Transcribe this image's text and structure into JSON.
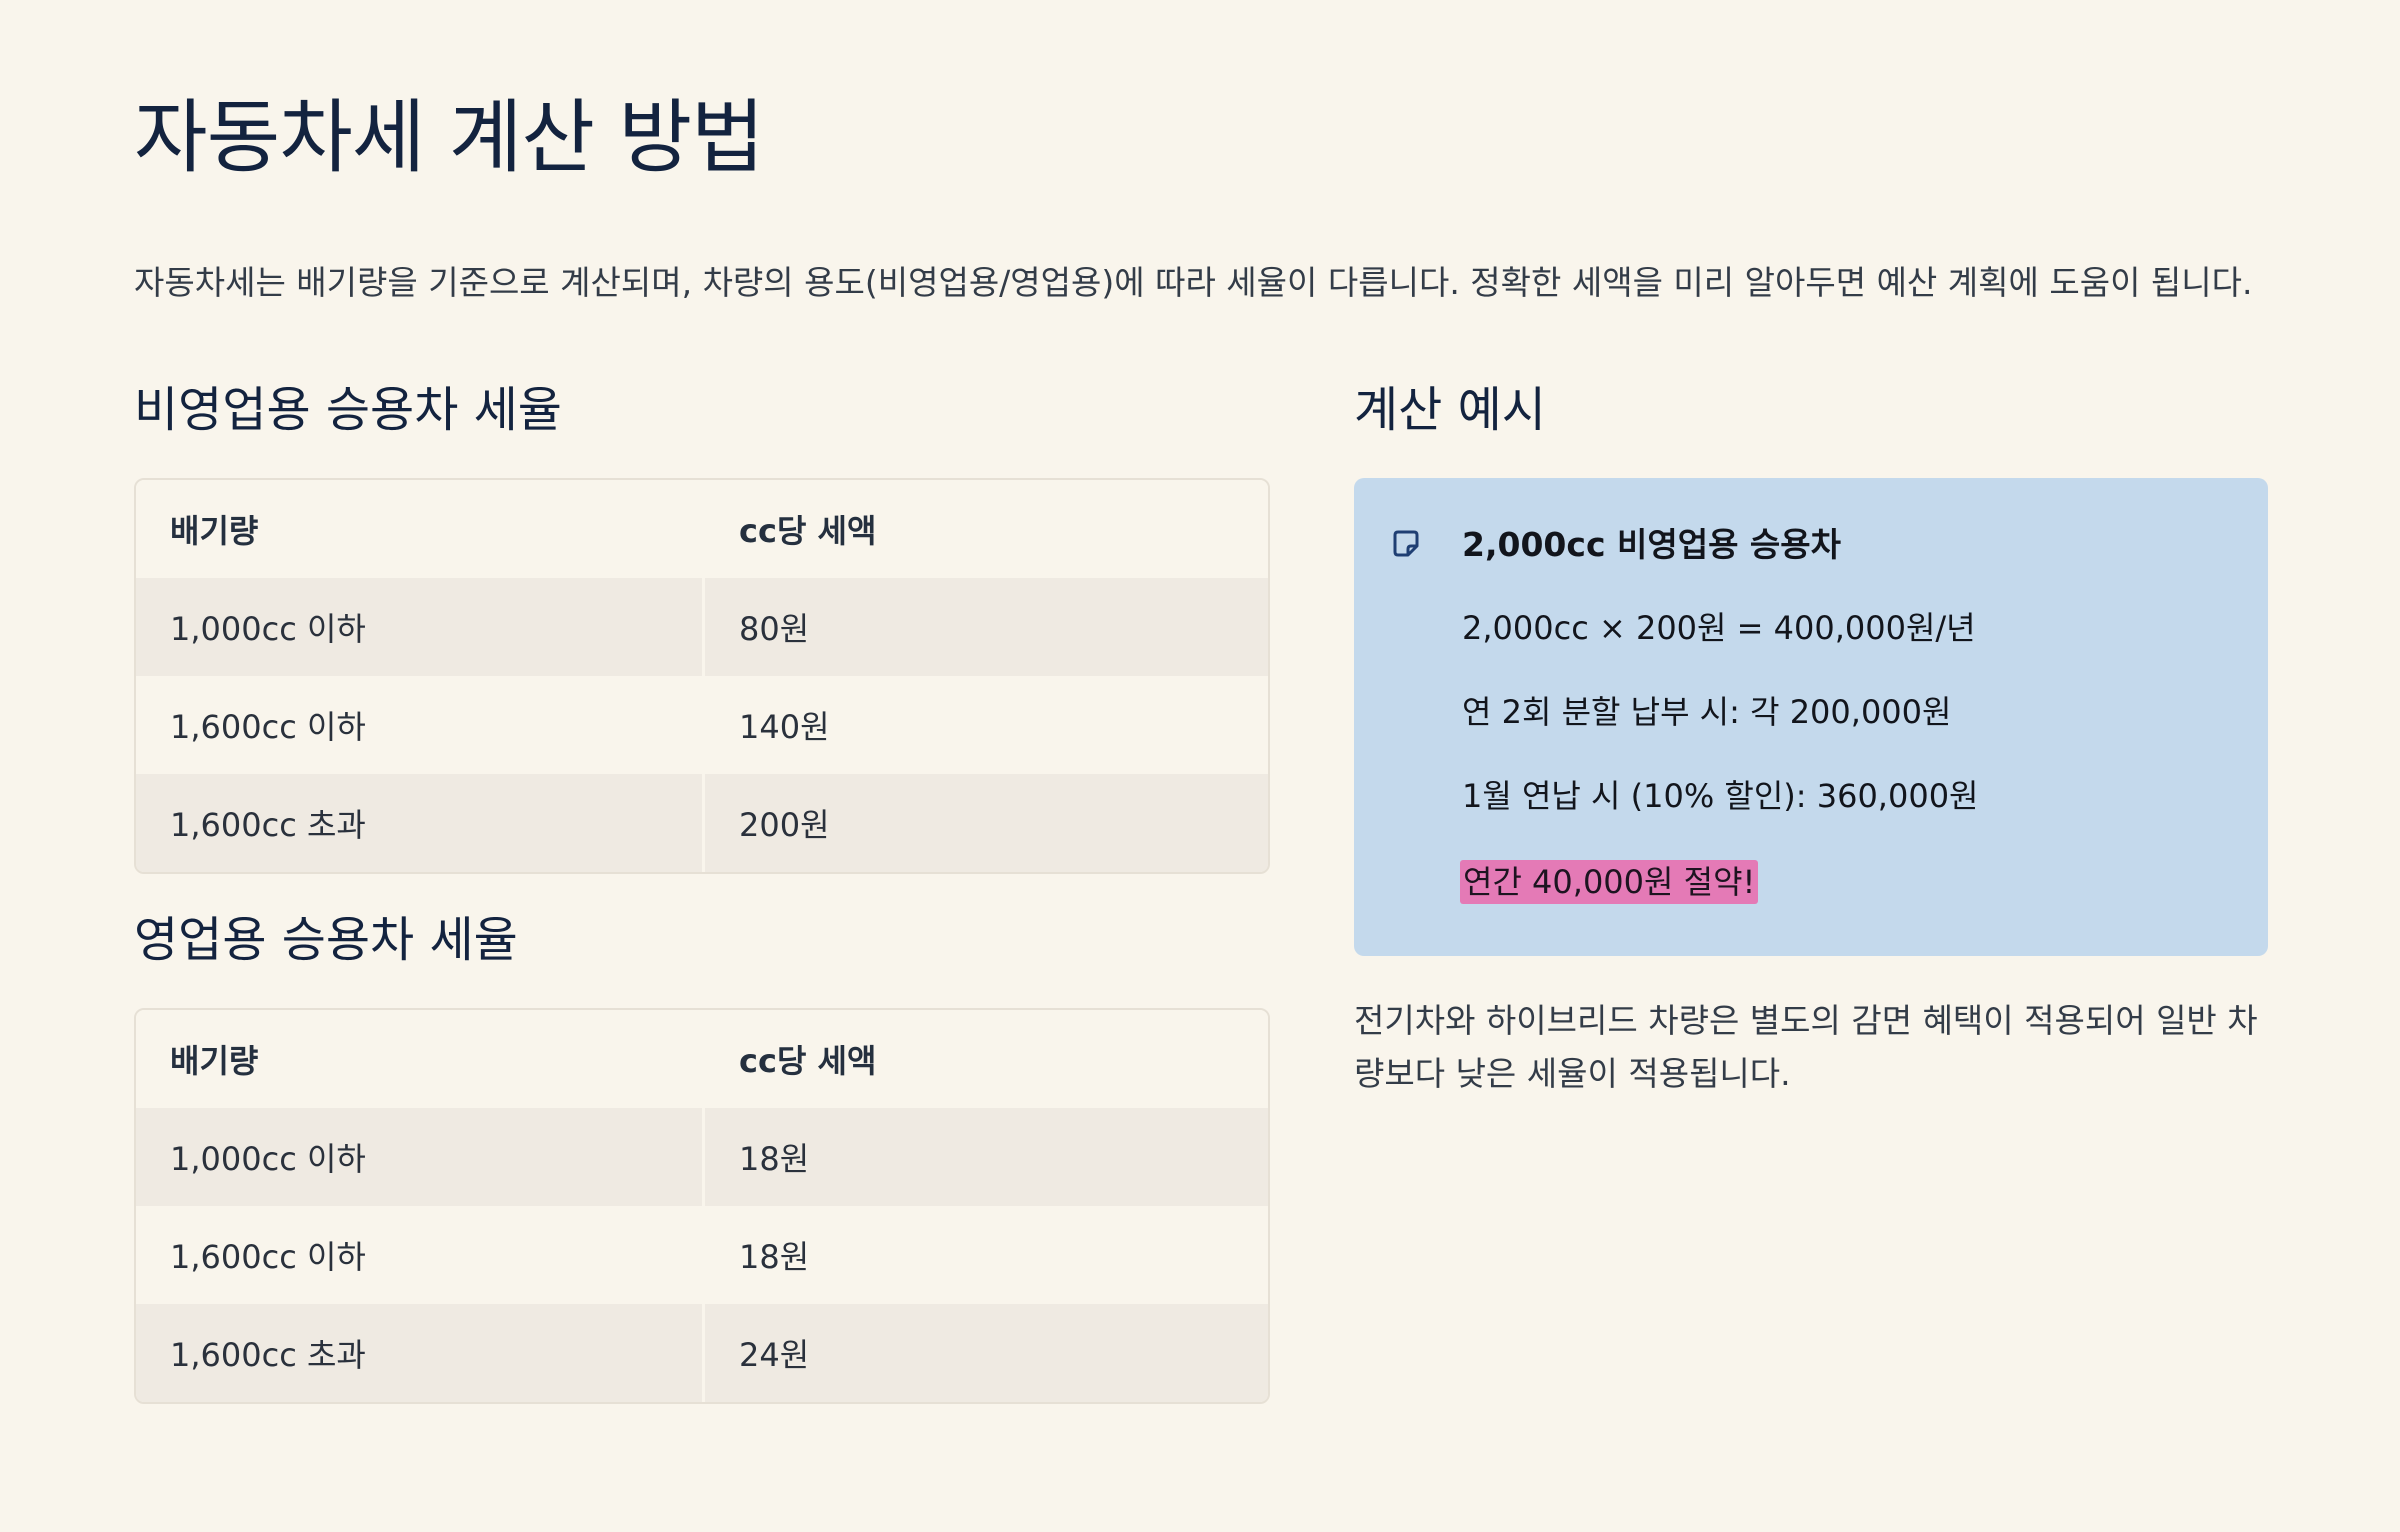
{
  "title": "자동차세 계산 방법",
  "intro": "자동차세는 배기량을 기준으로 계산되며, 차량의 용도(비영업용/영업용)에 따라 세율이 다릅니다. 정확한 세액을 미리 알아두면 예산 계획에 도움이 됩니다.",
  "non_commercial": {
    "heading": "비영업용 승용차 세율",
    "columns": [
      "배기량",
      "cc당 세액"
    ],
    "rows": [
      [
        "1,000cc 이하",
        "80원"
      ],
      [
        "1,600cc 이하",
        "140원"
      ],
      [
        "1,600cc 초과",
        "200원"
      ]
    ]
  },
  "commercial": {
    "heading": "영업용 승용차 세율",
    "columns": [
      "배기량",
      "cc당 세액"
    ],
    "rows": [
      [
        "1,000cc 이하",
        "18원"
      ],
      [
        "1,600cc 이하",
        "18원"
      ],
      [
        "1,600cc 초과",
        "24원"
      ]
    ]
  },
  "example": {
    "heading": "계산 예시",
    "icon": "note-icon",
    "title": "2,000cc 비영업용 승용차",
    "lines": [
      "2,000cc × 200원 = 400,000원/년",
      "연 2회 분할 납부 시: 각 200,000원",
      "1월 연납 시 (10% 할인): 360,000원"
    ],
    "highlight": "연간 40,000원 절약!",
    "highlight_color": "#e47ab6",
    "box_color": "#c4d9ec"
  },
  "footnote": "전기차와 하이브리드 차량은 별도의 감면 혜택이 적용되어 일반 차량보다 낮은 세율이 적용됩니다."
}
